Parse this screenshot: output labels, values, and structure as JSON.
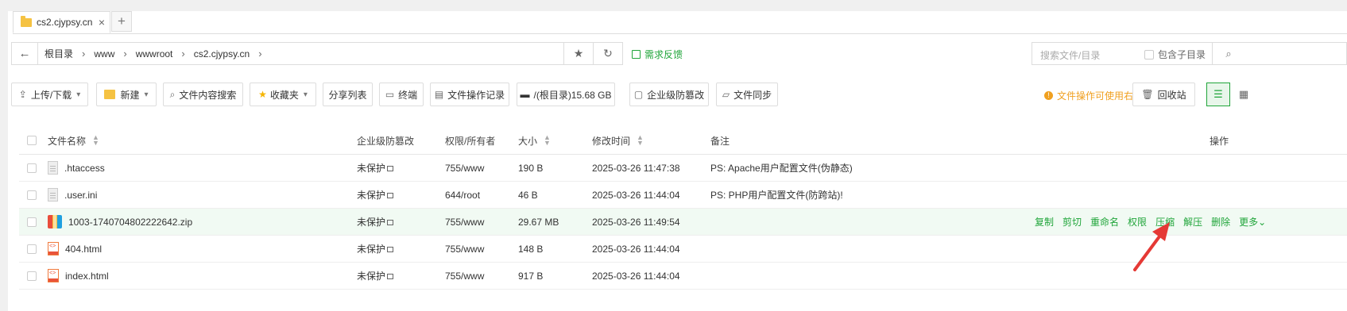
{
  "tab": {
    "label": "cs2.cjypsy.cn",
    "close": "×",
    "add": "+"
  },
  "path": {
    "crumbs": [
      "根目录",
      "www",
      "wwwroot",
      "cs2.cjypsy.cn"
    ],
    "sep": "›"
  },
  "feedback": "需求反馈",
  "search": {
    "placeholder": "搜索文件/目录",
    "include_sub": "包含子目录"
  },
  "toolbar": {
    "upload": "上传/下载",
    "new": "新建",
    "content_search": "文件内容搜索",
    "favorites": "收藏夹",
    "share_list": "分享列表",
    "terminal": "终端",
    "op_log": "文件操作记录",
    "disk": "/(根目录)15.68 GB",
    "tamper": "企业级防篡改",
    "sync": "文件同步",
    "tip": "文件操作可使用右键",
    "recycle": "回收站"
  },
  "table": {
    "headers": {
      "name": "文件名称",
      "protect": "企业级防篡改",
      "perm": "权限/所有者",
      "size": "大小",
      "mtime": "修改时间",
      "note": "备注",
      "ops": "操作"
    },
    "rows": [
      {
        "name": ".htaccess",
        "protect": "未保护",
        "perm": "755/www",
        "size": "190 B",
        "mtime": "2025-03-26 11:47:38",
        "note": "PS: Apache用户配置文件(伪静态)",
        "icon": "text-file-icon"
      },
      {
        "name": ".user.ini",
        "protect": "未保护",
        "perm": "644/root",
        "size": "46 B",
        "mtime": "2025-03-26 11:44:04",
        "note": "PS: PHP用户配置文件(防跨站)!",
        "icon": "text-file-icon"
      },
      {
        "name": "1003-1740704802222642.zip",
        "protect": "未保护",
        "perm": "755/www",
        "size": "29.67 MB",
        "mtime": "2025-03-26 11:49:54",
        "note": "",
        "icon": "zip-file-icon"
      },
      {
        "name": "404.html",
        "protect": "未保护",
        "perm": "755/www",
        "size": "148 B",
        "mtime": "2025-03-26 11:44:04",
        "note": "",
        "icon": "html-file-icon"
      },
      {
        "name": "index.html",
        "protect": "未保护",
        "perm": "755/www",
        "size": "917 B",
        "mtime": "2025-03-26 11:44:04",
        "note": "",
        "icon": "html-file-icon"
      }
    ],
    "row_actions": [
      "复制",
      "剪切",
      "重命名",
      "权限",
      "压缩",
      "解压",
      "删除",
      "更多"
    ]
  },
  "colors": {
    "accent": "#20a53a",
    "warning": "#f0a020",
    "arrow": "#e53935"
  }
}
